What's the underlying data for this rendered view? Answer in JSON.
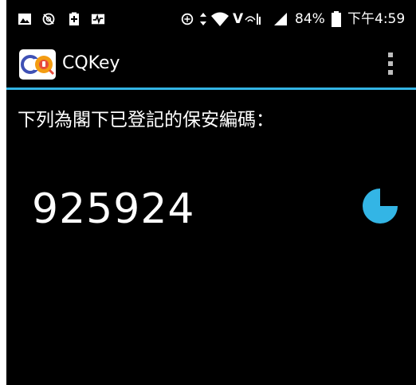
{
  "status_bar": {
    "battery_percent": "84%",
    "time": "下午4:59",
    "volte_label": "V",
    "icons": [
      "image-icon",
      "camera-off-icon",
      "battery-charging-icon",
      "activity-icon",
      "sync-icon",
      "data-arrows-icon",
      "wifi-icon",
      "volte-icon",
      "signal-icon",
      "battery-icon"
    ]
  },
  "app_bar": {
    "logo_text": "CQ",
    "title": "CQKey",
    "menu_icon": "overflow-menu-icon"
  },
  "content": {
    "instruction": "下列為閣下已登記的保安編碼：",
    "code": "925924",
    "timer_remaining_fraction": 0.25,
    "timer_icon": "countdown-pie-icon"
  },
  "colors": {
    "accent": "#33b5e5",
    "background": "#000000",
    "text": "#ffffff"
  }
}
